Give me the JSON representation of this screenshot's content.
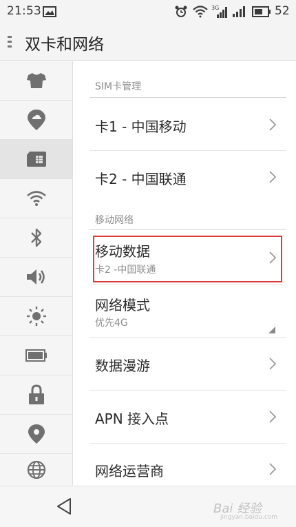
{
  "status_bar": {
    "time": "21:53",
    "battery_level": "52",
    "icons": [
      "image-icon",
      "alarm-icon",
      "wifi-icon",
      "signal-4g-icon",
      "signal-icon",
      "battery-icon"
    ]
  },
  "title_bar": {
    "title": "双卡和网络",
    "menu_icon": "overflow-menu-icon"
  },
  "sidebar": {
    "items": [
      {
        "icon": "tshirt-icon"
      },
      {
        "icon": "cloud-location-icon"
      },
      {
        "icon": "sim-card-icon",
        "active": true
      },
      {
        "icon": "wifi-icon"
      },
      {
        "icon": "bluetooth-icon"
      },
      {
        "icon": "volume-icon"
      },
      {
        "icon": "brightness-icon"
      },
      {
        "icon": "battery-icon"
      },
      {
        "icon": "lock-icon"
      },
      {
        "icon": "location-pin-icon"
      },
      {
        "icon": "globe-icon"
      }
    ]
  },
  "content": {
    "sim_section": {
      "header": "SIM卡管理",
      "items": [
        {
          "label": "卡1 - 中国移动"
        },
        {
          "label": "卡2 - 中国联通"
        }
      ]
    },
    "mobile_section": {
      "header": "移动网络",
      "items": [
        {
          "label": "移动数据",
          "sub": "卡2 -中国联通"
        },
        {
          "label": "网络模式",
          "sub": "优先4G"
        },
        {
          "label": "数据漫游"
        },
        {
          "label": "APN 接入点"
        },
        {
          "label": "网络运营商"
        }
      ]
    }
  },
  "nav_bar": {
    "back_icon": "back-triangle-icon"
  },
  "watermark": {
    "text": "Bai 经验",
    "url": "jingyan.baidu.com"
  },
  "colors": {
    "highlight": "#e0393e",
    "icon_gray": "#707070"
  }
}
